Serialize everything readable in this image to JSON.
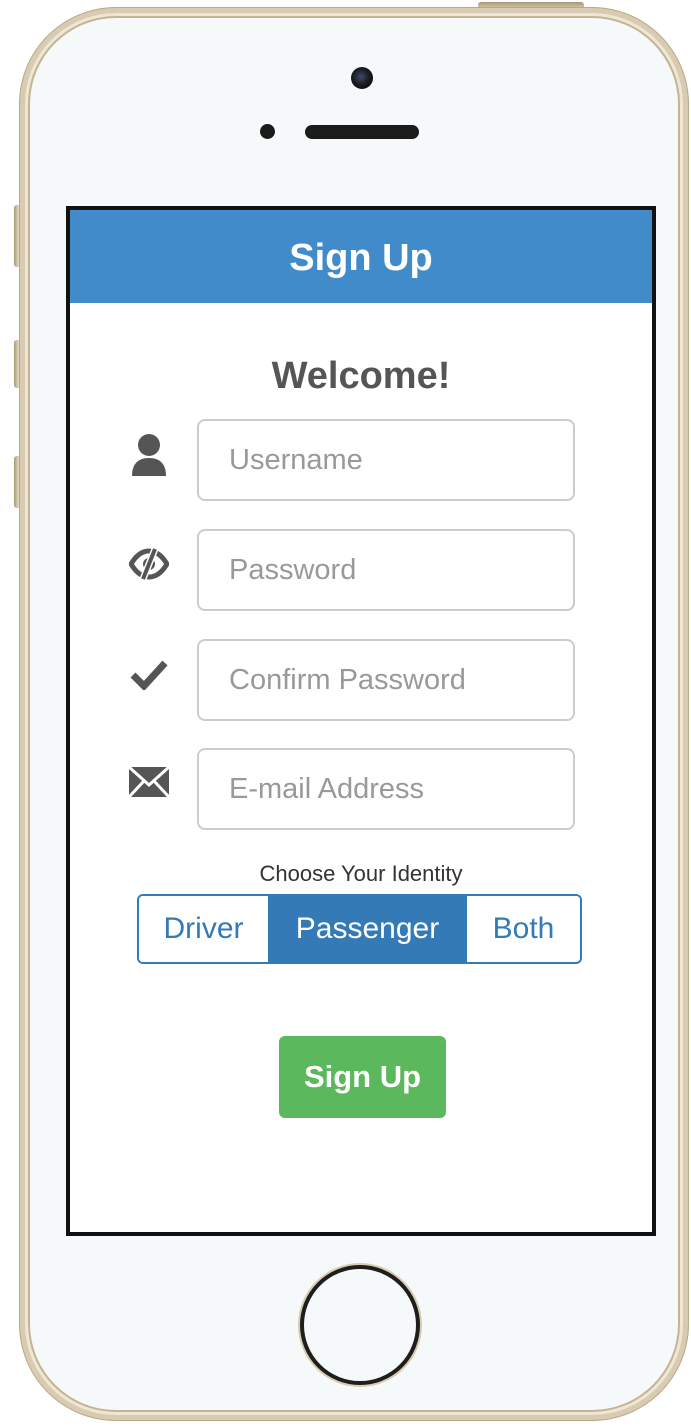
{
  "header": {
    "title": "Sign Up"
  },
  "welcome": "Welcome!",
  "fields": [
    {
      "icon": "user-icon",
      "placeholder": "Username"
    },
    {
      "icon": "eye-slash-icon",
      "placeholder": "Password"
    },
    {
      "icon": "check-icon",
      "placeholder": "Confirm Password"
    },
    {
      "icon": "envelope-icon",
      "placeholder": "E-mail Address"
    }
  ],
  "identity": {
    "label": "Choose Your Identity",
    "options": [
      "Driver",
      "Passenger",
      "Both"
    ],
    "selected": "Passenger"
  },
  "submit": {
    "label": "Sign Up"
  },
  "colors": {
    "header": "#428bca",
    "segment": "#337ab7",
    "submit": "#5cb85c"
  }
}
